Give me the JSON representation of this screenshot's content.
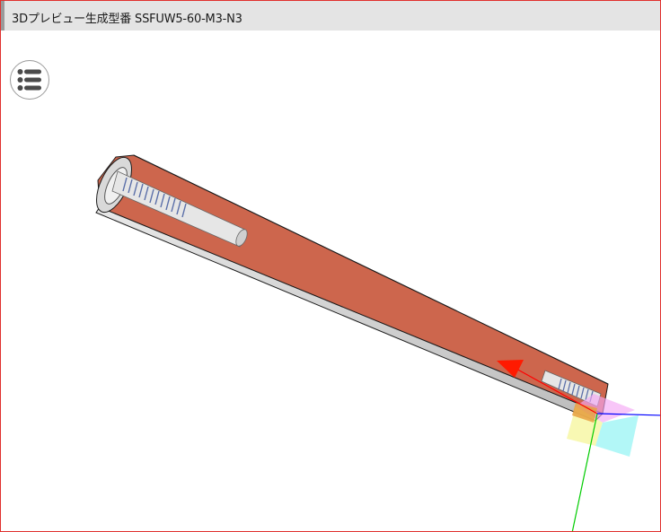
{
  "window": {
    "title": "3Dプレビュー生成型番 SSFUW5-60-M3-N3"
  },
  "menu_button": {
    "icon": "list-menu-icon"
  },
  "viewport": {
    "model": {
      "body_color": "#cd664d",
      "edge_color": "#1a1a1a",
      "thread_color": "#5a6ea8"
    },
    "axes": {
      "x_color": "#ff0000",
      "y_color": "#00cc00",
      "z_color": "#0000ff"
    },
    "gizmo": {
      "face_colors": [
        "#9ff5f5",
        "#f5f59a",
        "#f4a8f4",
        "#e8a040"
      ]
    }
  }
}
